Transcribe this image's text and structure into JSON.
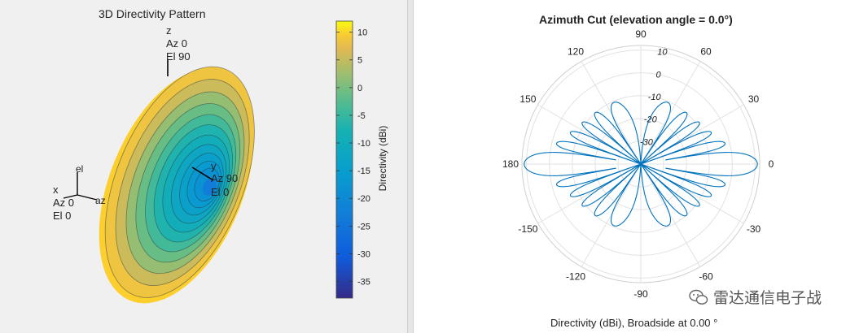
{
  "left_figure": {
    "title": "3D Directivity Pattern",
    "z_axis": [
      "z",
      "Az 0",
      "El 90"
    ],
    "y_axis": [
      "y",
      "Az 90",
      "El 0"
    ],
    "x_axis": [
      "x",
      "Az 0",
      "El 0"
    ],
    "triad": {
      "el": "el",
      "az": "az"
    },
    "colorbar": {
      "label": "Directivity (dBi)",
      "ticks": [
        "10",
        "5",
        "0",
        "-5",
        "-10",
        "-15",
        "-20",
        "-25",
        "-30",
        "-35"
      ],
      "range": [
        -38,
        12
      ]
    }
  },
  "right_figure": {
    "caption": "Directivity (dBi), Broadside at 0.00 °"
  },
  "watermark": "雷达通信电子战",
  "chart_data": [
    {
      "type": "surface",
      "title": "3D Directivity Pattern",
      "colorbar_label": "Directivity (dBi)",
      "colorbar_range": [
        -38,
        12
      ],
      "colorbar_ticks": [
        10,
        5,
        0,
        -5,
        -10,
        -15,
        -20,
        -25,
        -30,
        -35
      ]
    },
    {
      "type": "polar",
      "title": "Azimuth Cut (elevation angle = 0.0°)",
      "angle_ticks": [
        "0",
        "30",
        "60",
        "90",
        "120",
        "150",
        "180",
        "-150",
        "-120",
        "-90",
        "-60",
        "-30"
      ],
      "radial_ticks": [
        "10",
        "0",
        "-10",
        "-20",
        "-30"
      ],
      "rlim": [
        -40,
        12
      ],
      "angle_direction": "counterclockwise from 0° at right",
      "series": [
        {
          "pattern": "broadside array, symmetric about 0°-180° axis",
          "main_lobe_dBi": 11,
          "main_lobe_directions_deg": [
            0,
            180
          ],
          "sidelobe_count_per_half": 10
        }
      ],
      "grid": true
    }
  ]
}
